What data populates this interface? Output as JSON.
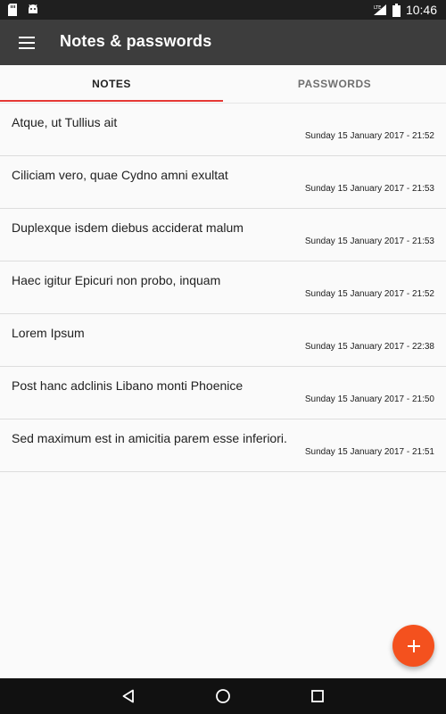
{
  "status_bar": {
    "time": "10:46",
    "network": "LTE",
    "icons": [
      "sd-card-icon",
      "android-icon",
      "signal-icon",
      "battery-icon"
    ]
  },
  "app_bar": {
    "title": "Notes & passwords",
    "menu_icon": "menu-icon"
  },
  "tabs": [
    {
      "label": "NOTES",
      "selected": true
    },
    {
      "label": "PASSWORDS",
      "selected": false
    }
  ],
  "notes": [
    {
      "title": "Atque, ut Tullius ait",
      "date": "Sunday 15 January 2017 - 21:52"
    },
    {
      "title": "Ciliciam vero, quae Cydno amni exultat",
      "date": "Sunday 15 January 2017 - 21:53"
    },
    {
      "title": "Duplexque isdem diebus acciderat malum",
      "date": "Sunday 15 January 2017 - 21:53"
    },
    {
      "title": "Haec igitur Epicuri non probo, inquam",
      "date": "Sunday 15 January 2017 - 21:52"
    },
    {
      "title": "Lorem Ipsum",
      "date": "Sunday 15 January 2017 - 22:38"
    },
    {
      "title": "Post hanc adclinis Libano monti Phoenice",
      "date": "Sunday 15 January 2017 - 21:50"
    },
    {
      "title": "Sed maximum est in amicitia parem esse inferiori.",
      "date": "Sunday 15 January 2017 - 21:51"
    }
  ],
  "fab": {
    "icon": "plus-icon"
  },
  "colors": {
    "app_bar": "#3d3d3d",
    "accent": "#e53935",
    "fab": "#f4511e",
    "status_bar": "#1f1f1f",
    "nav_bar": "#111111"
  },
  "nav_bar": {
    "icons": [
      "back-icon",
      "home-icon",
      "recents-icon"
    ]
  }
}
